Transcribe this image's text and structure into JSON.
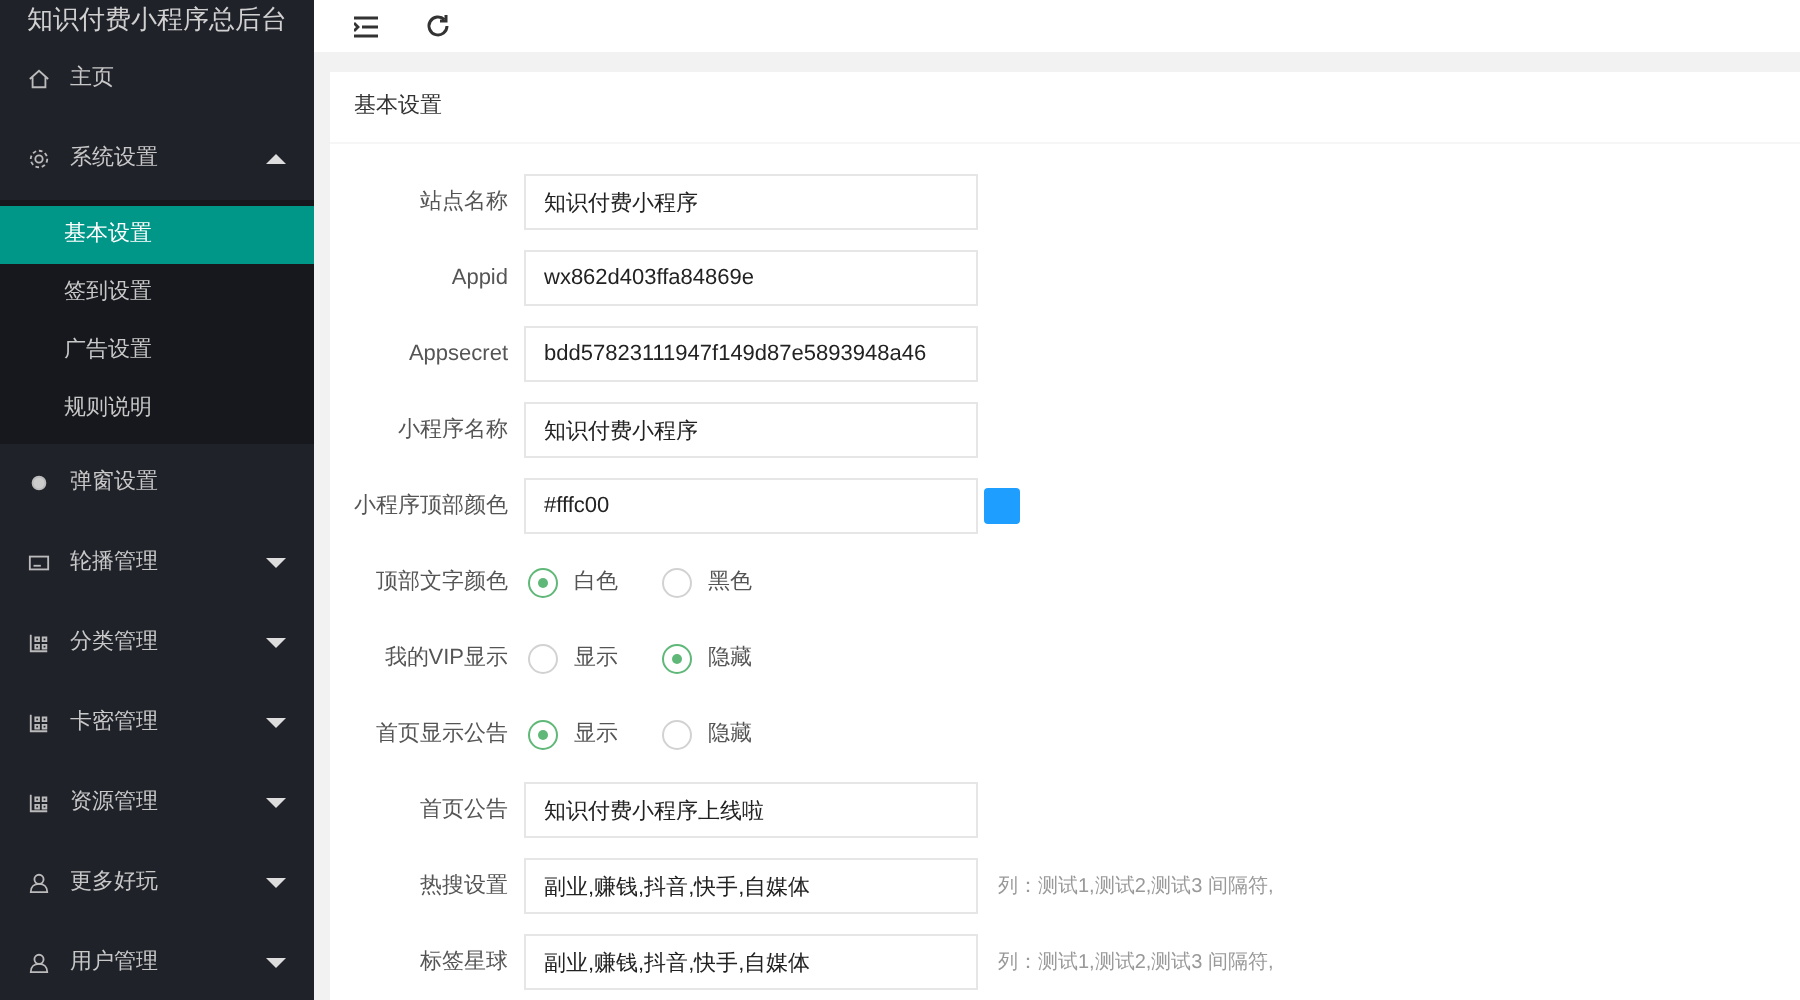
{
  "sidebar": {
    "title": "知识付费小程序总后台",
    "items": [
      {
        "kind": "link",
        "label": "主页",
        "selected": false
      },
      {
        "kind": "group",
        "label": "系统设置",
        "selected": false,
        "expanded": true,
        "children": [
          {
            "label": "基本设置",
            "selected": true
          },
          {
            "label": "签到设置",
            "selected": false
          },
          {
            "label": "广告设置",
            "selected": false
          },
          {
            "label": "规则说明",
            "selected": false
          }
        ]
      },
      {
        "kind": "link",
        "label": "弹窗设置",
        "selected": false
      },
      {
        "kind": "group",
        "label": "轮播管理",
        "selected": false,
        "expanded": false
      },
      {
        "kind": "group",
        "label": "分类管理",
        "selected": false,
        "expanded": false
      },
      {
        "kind": "group",
        "label": "卡密管理",
        "selected": false,
        "expanded": false
      },
      {
        "kind": "group",
        "label": "资源管理",
        "selected": false,
        "expanded": false
      },
      {
        "kind": "group",
        "label": "更多好玩",
        "selected": false,
        "expanded": false
      },
      {
        "kind": "group",
        "label": "用户管理",
        "selected": false,
        "expanded": false
      }
    ]
  },
  "card": {
    "title": "基本设置",
    "rows": [
      {
        "kind": "text",
        "label": "站点名称",
        "value": "知识付费小程序"
      },
      {
        "kind": "text",
        "label": "Appid",
        "value": "wx862d403ffa84869e"
      },
      {
        "kind": "text",
        "label": "Appsecret",
        "value": "bdd57823111947f149d87e5893948a46"
      },
      {
        "kind": "text",
        "label": "小程序名称",
        "value": "知识付费小程序"
      },
      {
        "kind": "color",
        "label": "小程序顶部颜色",
        "value": "#fffc00",
        "color": "#1e9fff"
      },
      {
        "kind": "radio",
        "label": "顶部文字颜色",
        "options": [
          {
            "label": "白色",
            "selected": true
          },
          {
            "label": "黑色",
            "selected": false
          }
        ]
      },
      {
        "kind": "radio",
        "label": "我的VIP显示",
        "options": [
          {
            "label": "显示",
            "selected": false
          },
          {
            "label": "隐藏",
            "selected": true
          }
        ]
      },
      {
        "kind": "radio",
        "label": "首页显示公告",
        "options": [
          {
            "label": "显示",
            "selected": true
          },
          {
            "label": "隐藏",
            "selected": false
          }
        ]
      },
      {
        "kind": "text",
        "label": "首页公告",
        "value": "知识付费小程序上线啦"
      },
      {
        "kind": "text",
        "label": "热搜设置",
        "value": "副业,赚钱,抖音,快手,自媒体",
        "hint": "列：测试1,测试2,测试3 间隔符,"
      },
      {
        "kind": "text",
        "label": "标签星球",
        "value": "副业,赚钱,抖音,快手,自媒体",
        "hint": "列：测试1,测试2,测试3 间隔符,"
      }
    ]
  }
}
